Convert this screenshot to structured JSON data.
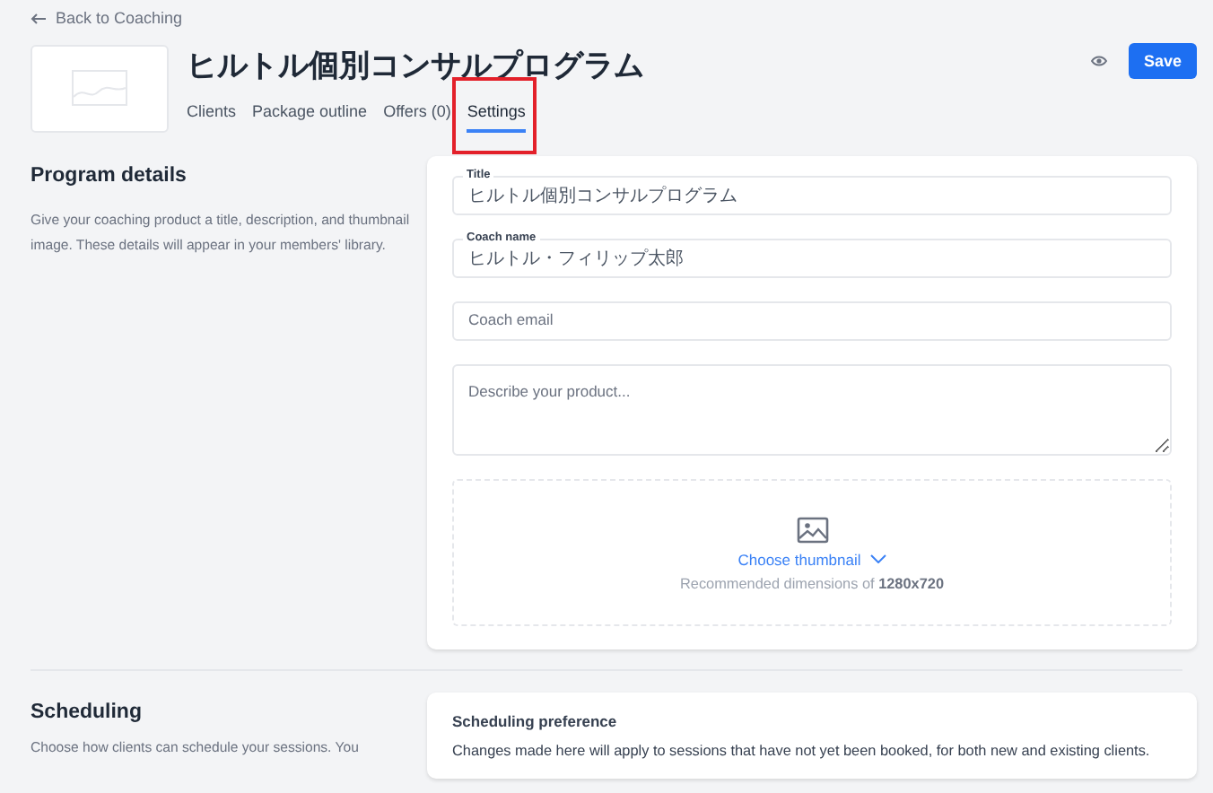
{
  "back_link": "Back to Coaching",
  "title": "ヒルトル個別コンサルプログラム",
  "tabs": [
    {
      "label": "Clients",
      "selected": false
    },
    {
      "label": "Package outline",
      "selected": false
    },
    {
      "label": "Offers (0)",
      "selected": false
    },
    {
      "label": "Settings",
      "selected": true,
      "highlighted": true
    }
  ],
  "save_button": "Save",
  "sections": [
    {
      "heading": "Program details",
      "description": "Give your coaching product a title, description, and thumbnail image. These details will appear in your members' library.",
      "fields": [
        {
          "kind": "input",
          "label": "Title",
          "value": "ヒルトル個別コンサルプログラム"
        },
        {
          "kind": "input",
          "label": "Coach name",
          "value": "ヒルトル・フィリップ太郎"
        },
        {
          "kind": "input",
          "placeholder": "Coach email"
        },
        {
          "kind": "textarea",
          "placeholder": "Describe your product..."
        }
      ],
      "thumbnail": {
        "link": "Choose thumbnail",
        "hint": "Recommended dimensions of **1280x720**"
      }
    },
    {
      "heading": "Scheduling",
      "description": "Choose how clients can schedule your sessions. You",
      "card_title": "Scheduling preference",
      "card_text": "Changes made here will apply to sessions that have not yet been booked, for both new and existing clients."
    }
  ]
}
